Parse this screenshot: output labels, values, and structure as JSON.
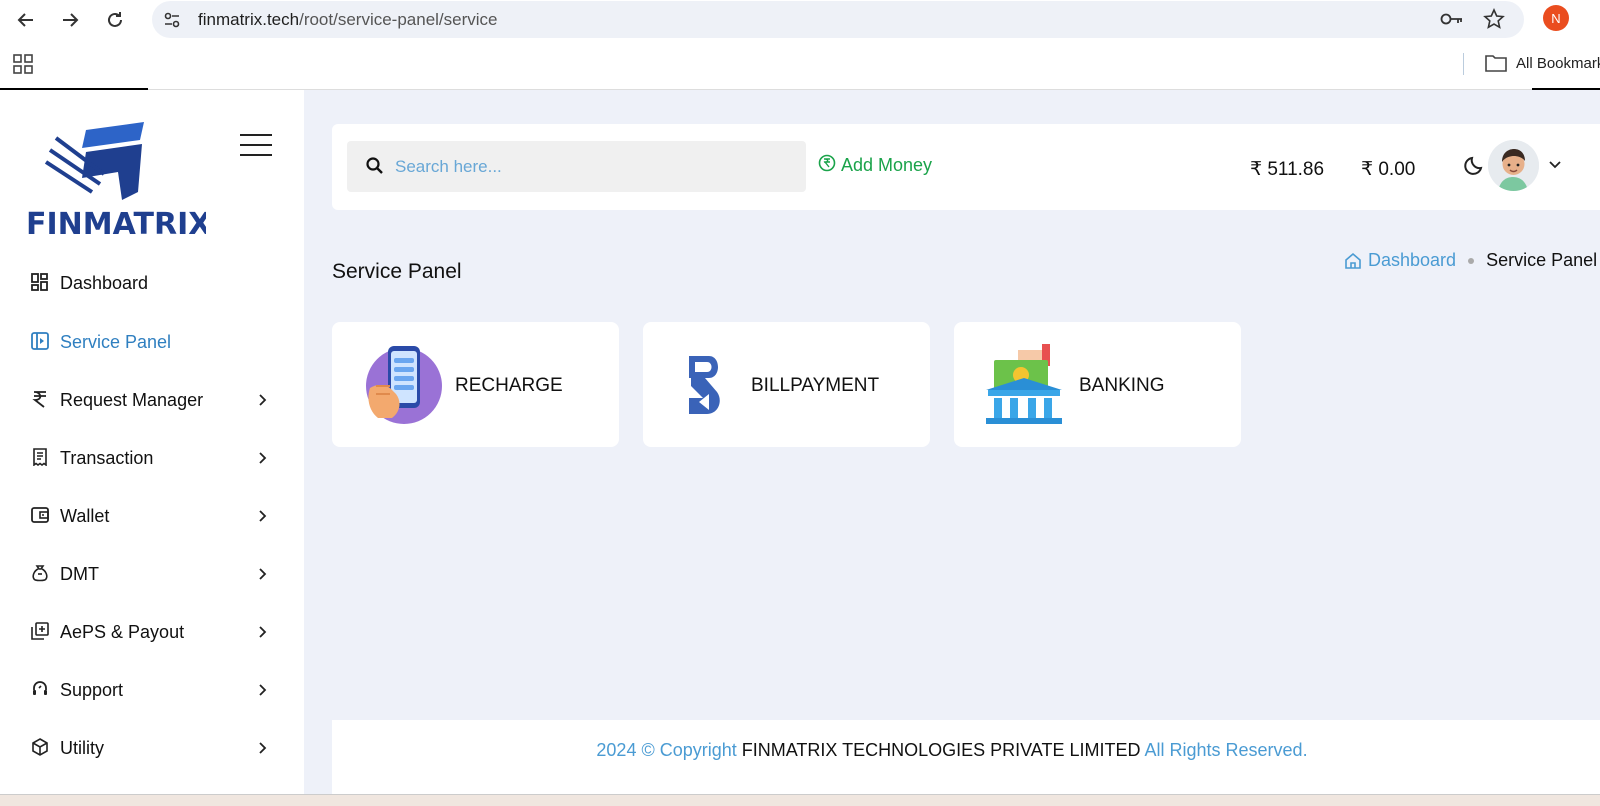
{
  "browser": {
    "url_host": "finmatrix.tech",
    "url_path": "/root/service-panel/service",
    "profile_initial": "N",
    "bookmarks_label": "All Bookmarks"
  },
  "sidebar": {
    "brand": "FINMATRIX",
    "items": [
      {
        "label": "Dashboard",
        "icon": "dashboard-icon",
        "has_children": false
      },
      {
        "label": "Service Panel",
        "icon": "service-panel-icon",
        "has_children": false,
        "active": true
      },
      {
        "label": "Request Manager",
        "icon": "rupee-icon",
        "has_children": true
      },
      {
        "label": "Transaction",
        "icon": "receipt-icon",
        "has_children": true
      },
      {
        "label": "Wallet",
        "icon": "wallet-icon",
        "has_children": true
      },
      {
        "label": "DMT",
        "icon": "money-bag-icon",
        "has_children": true
      },
      {
        "label": "AePS & Payout",
        "icon": "add-library-icon",
        "has_children": true
      },
      {
        "label": "Support",
        "icon": "headset-icon",
        "has_children": true
      },
      {
        "label": "Utility",
        "icon": "cube-icon",
        "has_children": true
      }
    ]
  },
  "topbar": {
    "search_placeholder": "Search here...",
    "add_money_label": "Add Money",
    "main_balance": "₹ 511.86",
    "secondary_balance": "₹ 0.00"
  },
  "page": {
    "title": "Service Panel",
    "breadcrumb_home": "Dashboard",
    "breadcrumb_current": "Service Panel"
  },
  "services": [
    {
      "label": "RECHARGE",
      "icon": "mobile-recharge-icon"
    },
    {
      "label": "BILLPAYMENT",
      "icon": "bbps-icon"
    },
    {
      "label": "BANKING",
      "icon": "bank-icon"
    }
  ],
  "footer": {
    "prefix": "2024 © Copyright",
    "company": "FINMATRIX TECHNOLOGIES PRIVATE LIMITED",
    "suffix": "All Rights Reserved."
  },
  "colors": {
    "accent": "#2f7fc0",
    "link": "#4a9bd3",
    "add_money_green": "#1aa34a",
    "brand_blue": "#1f3f8f",
    "background": "#eef1f9"
  }
}
